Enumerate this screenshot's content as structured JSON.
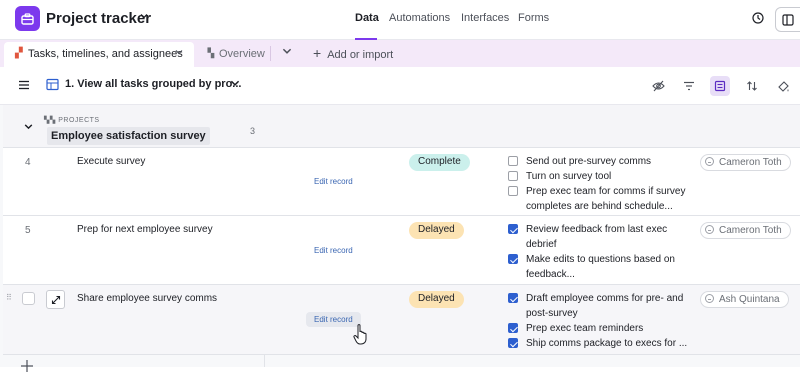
{
  "app": {
    "title": "Project tracker",
    "icon": "briefcase-icon",
    "accent": "#7c39ed"
  },
  "topnav": [
    {
      "label": "Data",
      "active": true
    },
    {
      "label": "Automations",
      "active": false
    },
    {
      "label": "Interfaces",
      "active": false
    },
    {
      "label": "Forms",
      "active": false
    }
  ],
  "tabs": {
    "active_table": "Tasks, timelines, and assignees",
    "second_table": "Overview",
    "add_import": "Add or import"
  },
  "view": {
    "name": "1. View all tasks grouped by pro..."
  },
  "group": {
    "kicker": "PROJECTS",
    "name": "Employee satisfaction survey",
    "count": "3"
  },
  "rows": [
    {
      "num": "4",
      "name": "Execute survey",
      "edit": "Edit record",
      "status": "Complete",
      "subtasks": [
        {
          "text": "Send out pre-survey comms",
          "checked": false
        },
        {
          "text": "Turn on survey tool",
          "checked": false
        },
        {
          "text": "Prep exec team for comms if survey completes are behind schedule...",
          "checked": false
        }
      ],
      "assignee": "Cameron Toth"
    },
    {
      "num": "5",
      "name": "Prep for next employee survey",
      "edit": "Edit record",
      "status": "Delayed",
      "subtasks": [
        {
          "text": "Review feedback from last exec debrief",
          "checked": true
        },
        {
          "text": "Make edits to questions based on feedback...",
          "checked": true
        }
      ],
      "assignee": "Cameron Toth"
    },
    {
      "num": "",
      "name": "Share employee survey comms",
      "edit": "Edit record",
      "status": "Delayed",
      "subtasks": [
        {
          "text": "Draft employee comms for pre- and post-survey",
          "checked": true
        },
        {
          "text": "Prep exec team reminders",
          "checked": true
        },
        {
          "text": "Ship comms package to execs for ...",
          "checked": true
        }
      ],
      "assignee": "Ash Quintana"
    }
  ],
  "colors": {
    "complete": "#cbf0ec",
    "delayed": "#fce3b3",
    "checkbox": "#2d5fcf",
    "tabbar": "#f4e9f9"
  }
}
